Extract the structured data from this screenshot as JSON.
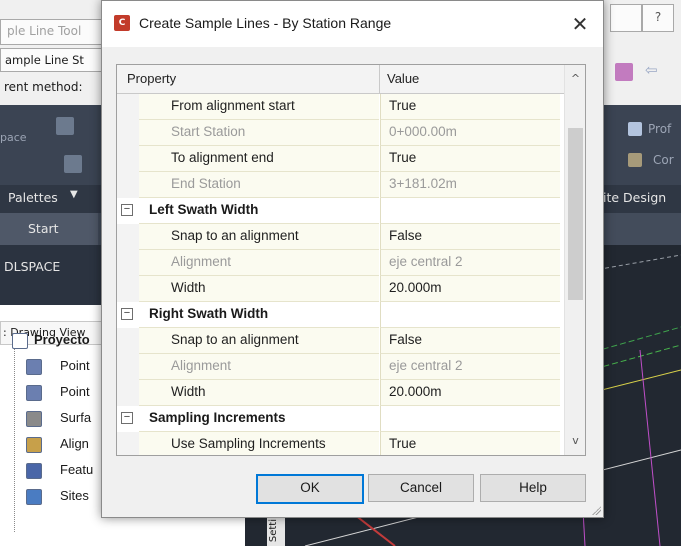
{
  "background": {
    "left_texts": {
      "sample_line_tools": "ple Line Tool",
      "sample_line_st": "ample Line St",
      "current_method": "rent method:",
      "space": "pace",
      "palettes": "Palettes",
      "start_tab": "Start",
      "modelspace": "DLSPACE",
      "drawing_view": ": Drawing View",
      "settings_vertical": "Setti"
    },
    "right_texts": {
      "prof": "Prof",
      "cor": "Cor",
      "site_design": "ite Design"
    },
    "prospector": [
      {
        "label": "Proyecto",
        "icon": "drawing-icon",
        "bold": true
      },
      {
        "label": "Point",
        "icon": "point-icon"
      },
      {
        "label": "Point",
        "icon": "point-group-icon"
      },
      {
        "label": "Surfa",
        "icon": "surface-icon"
      },
      {
        "label": "Align",
        "icon": "alignment-icon"
      },
      {
        "label": "Featu",
        "icon": "feature-line-icon"
      },
      {
        "label": "Sites",
        "icon": "sites-icon"
      }
    ]
  },
  "dialog": {
    "title": "Create Sample Lines - By Station Range",
    "close_glyph": "✕",
    "icon_label": "C",
    "columns": {
      "property": "Property",
      "value": "Value"
    },
    "rows": [
      {
        "property": "From alignment start",
        "value": "True",
        "state": "normal"
      },
      {
        "property": "Start Station",
        "value": "0+000.00m",
        "state": "disabled"
      },
      {
        "property": "To alignment end",
        "value": "True",
        "state": "normal"
      },
      {
        "property": "End Station",
        "value": "3+181.02m",
        "state": "disabled"
      },
      {
        "property": "Left Swath Width",
        "value": "",
        "state": "category"
      },
      {
        "property": "Snap to an alignment",
        "value": "False",
        "state": "normal"
      },
      {
        "property": "Alignment",
        "value": "eje central 2",
        "state": "disabled"
      },
      {
        "property": "Width",
        "value": "20.000m",
        "state": "normal"
      },
      {
        "property": "Right Swath Width",
        "value": "",
        "state": "category"
      },
      {
        "property": "Snap to an alignment",
        "value": "False",
        "state": "normal"
      },
      {
        "property": "Alignment",
        "value": "eje central 2",
        "state": "disabled"
      },
      {
        "property": "Width",
        "value": "20.000m",
        "state": "normal"
      },
      {
        "property": "Sampling Increments",
        "value": "",
        "state": "category"
      },
      {
        "property": "Use Sampling Increments",
        "value": "True",
        "state": "normal"
      }
    ],
    "collapse_glyph": "−",
    "buttons": {
      "ok": "OK",
      "cancel": "Cancel",
      "help": "Help"
    },
    "scroll_up_glyph": "^",
    "scroll_down_glyph": "v"
  },
  "colors": {
    "accent": "#0078d7",
    "disabled_text": "#9a9a9a",
    "value_cell_bg": "#fbfbf0"
  }
}
